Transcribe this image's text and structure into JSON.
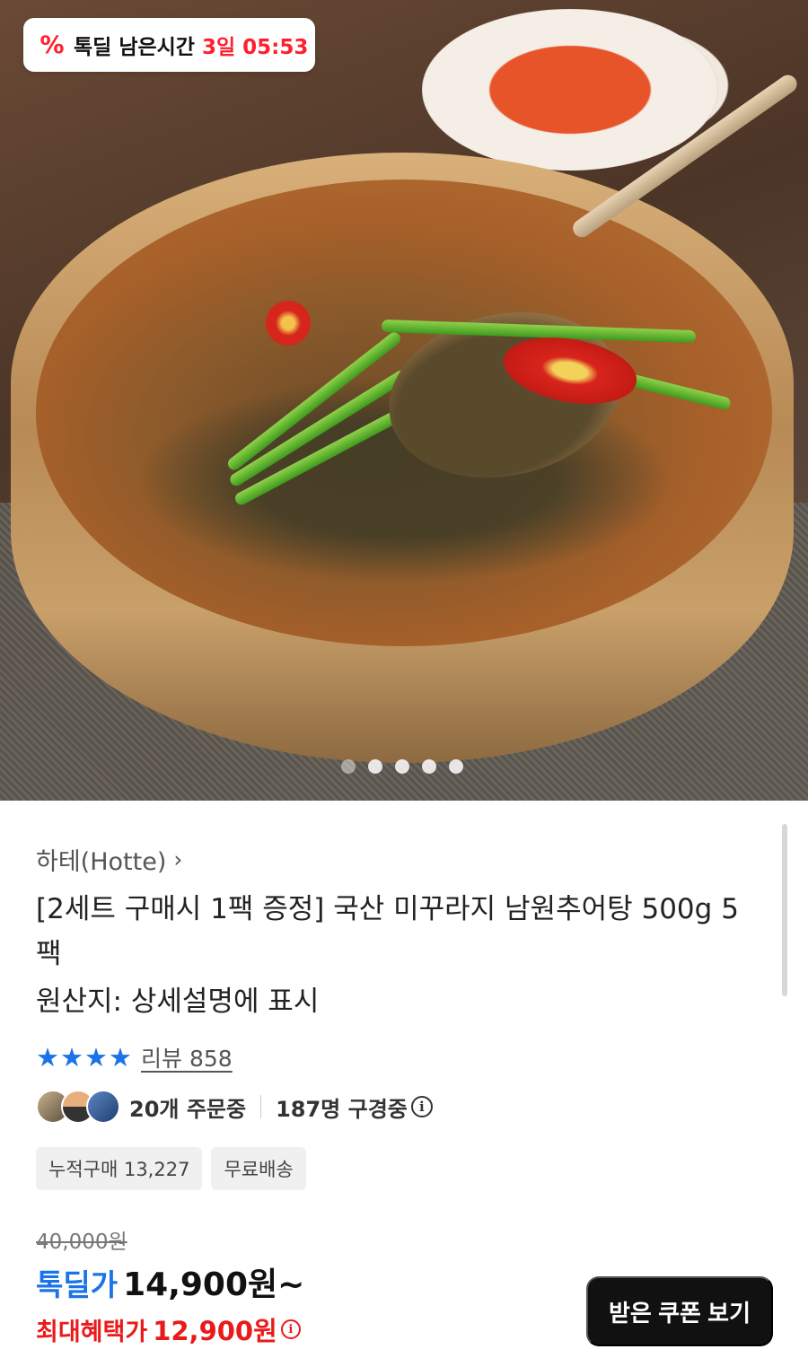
{
  "timer": {
    "label": "톡딜 남은시간",
    "remaining": "3일 05:53",
    "icon": "percent-tag-icon",
    "accent": "#ff1f2d"
  },
  "carousel": {
    "total": 5,
    "active_index": 0
  },
  "product": {
    "brand": "하테(Hotte)",
    "title": "[2세트 구매시 1팩 증정] 국산 미꾸라지 남원추어탕 500g 5팩",
    "origin": "원산지: 상세설명에 표시",
    "rating": {
      "stars": 4,
      "max_stars": 5,
      "review_text": "리뷰 858"
    },
    "social": {
      "ordering": "20개 주문중",
      "viewing": "187명 구경중"
    },
    "chips": [
      "누적구매 13,227",
      "무료배송"
    ],
    "price": {
      "original": "40,000원",
      "deal_label": "톡딜가",
      "deal_price": "14,900원~",
      "max_label": "최대혜택가",
      "max_price": "12,900원"
    }
  },
  "buttons": {
    "coupon": "받은 쿠폰 보기"
  },
  "colors": {
    "deal_blue": "#1a73e8",
    "max_red": "#ea1a1a",
    "button_bg": "#111111"
  }
}
